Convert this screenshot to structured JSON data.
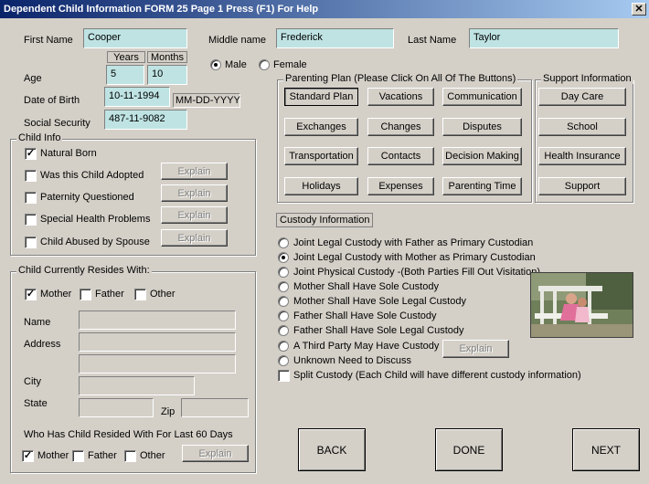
{
  "window": {
    "title": "Dependent Child Information FORM 25 Page 1   Press (F1) For Help",
    "close_glyph": "✕"
  },
  "name": {
    "first_label": "First Name",
    "first_value": "Cooper",
    "middle_label": "Middle name",
    "middle_value": "Frederick",
    "last_label": "Last Name",
    "last_value": "Taylor"
  },
  "age": {
    "label": "Age",
    "years_header": "Years",
    "months_header": "Months",
    "years": "5",
    "months": "10"
  },
  "gender": {
    "male": "Male",
    "female": "Female",
    "selected": "Male"
  },
  "dob": {
    "label": "Date of Birth",
    "value": "10-11-1994",
    "format_hint": "MM-DD-YYYY"
  },
  "ssn": {
    "label": "Social Security",
    "value": "487-11-9082"
  },
  "child_info": {
    "title": "Child Info",
    "items": [
      {
        "label": "Natural Born",
        "checked": true,
        "explain": ""
      },
      {
        "label": "Was this Child Adopted",
        "checked": false,
        "explain": "Explain"
      },
      {
        "label": "Paternity Questioned",
        "checked": false,
        "explain": "Explain"
      },
      {
        "label": "Special Health Problems",
        "checked": false,
        "explain": "Explain"
      },
      {
        "label": "Child Abused by Spouse",
        "checked": false,
        "explain": "Explain"
      }
    ]
  },
  "resides": {
    "title": "Child  Currently Resides With:",
    "mother": "Mother",
    "father": "Father",
    "other": "Other",
    "mother_checked": true,
    "name_label": "Name",
    "address_label": "Address",
    "city_label": "City",
    "state_label": "State",
    "zip_label": "Zip",
    "last60_label": "Who Has Child Resided With For Last 60 Days",
    "last60_mother": "Mother",
    "last60_father": "Father",
    "last60_other": "Other",
    "last60_explain": "Explain"
  },
  "parenting": {
    "title": "Parenting Plan (Please Click On All Of The Buttons)",
    "buttons": [
      "Standard Plan",
      "Vacations",
      "Communication",
      "Exchanges",
      "Changes",
      "Disputes",
      "Transportation",
      "Contacts",
      "Decision Making",
      "Holidays",
      "Expenses",
      "Parenting Time"
    ]
  },
  "support": {
    "title": "Support Information",
    "buttons": [
      "Day Care",
      "School",
      "Health Insurance",
      "Support"
    ]
  },
  "custody": {
    "title": "Custody Information",
    "options": [
      "Joint Legal Custody with Father as Primary Custodian",
      "Joint Legal Custody with Mother as Primary Custodian",
      "Joint Physical Custody -(Both Parties Fill Out Visitation)",
      "Mother Shall Have Sole Custody",
      "Mother Shall Have Sole Legal Custody",
      "Father Shall Have Sole Custody",
      "Father Shall Have Sole Legal Custody",
      "A Third Party May Have Custody",
      "Unknown Need to Discuss"
    ],
    "selected_index": 1,
    "third_party_explain": "Explain",
    "split_label": "Split Custody (Each Child will have different custody information)"
  },
  "nav": {
    "back": "BACK",
    "done": "DONE",
    "next": "NEXT"
  },
  "colors": {
    "field_bg": "#bfe3e3",
    "window_bg": "#d4d0c8",
    "title_start": "#0a246a",
    "title_end": "#a6caf0"
  }
}
